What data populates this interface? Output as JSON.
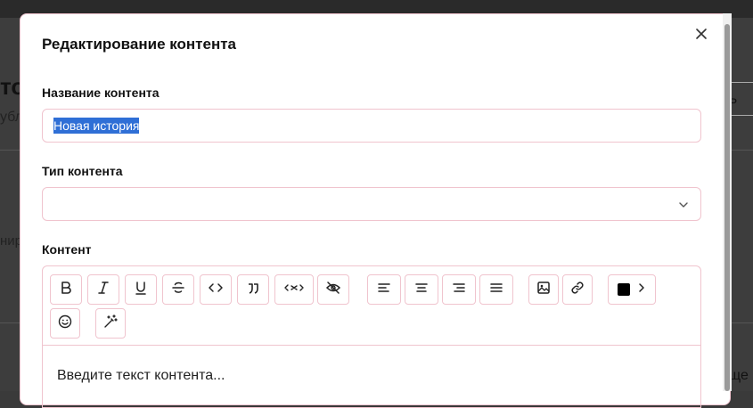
{
  "background": {
    "heading_fragment": "то",
    "subtitle_fragment": "убл",
    "mid_fragment": "нир",
    "right_button_fragment": "Ь",
    "right_bottom_fragment": "ще"
  },
  "modal": {
    "title": "Редактирование контента",
    "close_icon": "close-icon",
    "name_field": {
      "label": "Название контента",
      "value": "Новая история"
    },
    "type_field": {
      "label": "Тип контента",
      "value": ""
    },
    "content_field": {
      "label": "Контент",
      "placeholder": "Введите текст контента...",
      "toolbar": [
        "bold-icon",
        "italic-icon",
        "underline-icon",
        "strikethrough-icon",
        "code-icon",
        "quote-icon",
        "code-block-icon",
        "hide-icon",
        "align-left-icon",
        "align-center-icon",
        "align-right-icon",
        "align-justify-icon",
        "image-icon",
        "link-icon",
        "text-color",
        "emoji-icon",
        "magic-wand-icon"
      ],
      "text_color": "#000000"
    }
  },
  "colors": {
    "accent_border": "#f0c4ce",
    "selection": "#2f6fd6"
  }
}
